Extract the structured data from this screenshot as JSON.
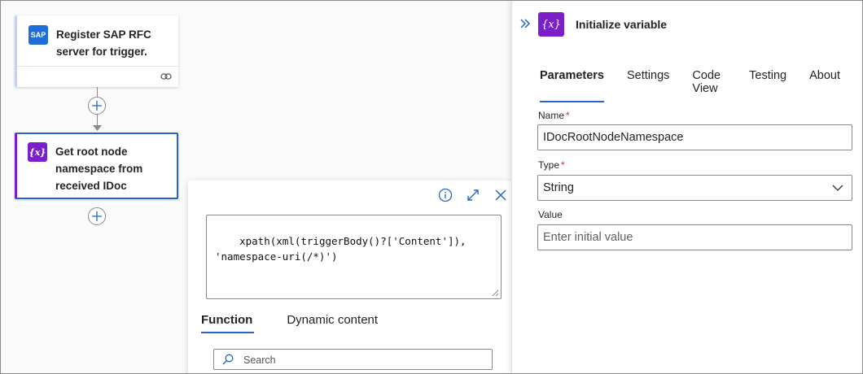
{
  "canvas": {
    "sap_node": {
      "title": "Register SAP RFC server for trigger.",
      "icon_text": "SAP",
      "icon": "sap-logo-icon",
      "footer_icon": "link-icon"
    },
    "variable_node": {
      "title": "Get root node namespace from received IDoc",
      "icon_text": "{x}",
      "icon": "variable-icon"
    },
    "add_step_icon": "plus-icon",
    "accent_color": "#7a1fc9"
  },
  "editor": {
    "expression": "xpath(xml(triggerBody()?['Content']),\n'namespace-uri(/*)')",
    "tools": [
      "info-icon",
      "expand-icon",
      "close-icon"
    ],
    "tabs": [
      {
        "label": "Function",
        "active": true
      },
      {
        "label": "Dynamic content",
        "active": false
      }
    ],
    "search_placeholder": "Search"
  },
  "pane": {
    "title": "Initialize variable",
    "icon_text": "{x}",
    "tabs": [
      {
        "label": "Parameters",
        "active": true
      },
      {
        "label": "Settings",
        "active": false
      },
      {
        "label": "Code View",
        "active": false
      },
      {
        "label": "Testing",
        "active": false
      },
      {
        "label": "About",
        "active": false
      }
    ],
    "fields": {
      "name_label": "Name",
      "name_value": "IDocRootNodeNamespace",
      "type_label": "Type",
      "type_value": "String",
      "value_label": "Value",
      "value_placeholder": "Enter initial value",
      "required_mark": "*"
    }
  },
  "colors": {
    "active_tab": "#2266cc",
    "selected_border": "#2266cc",
    "required": "#c4314b",
    "sap_blue": "#1f6ed6"
  }
}
